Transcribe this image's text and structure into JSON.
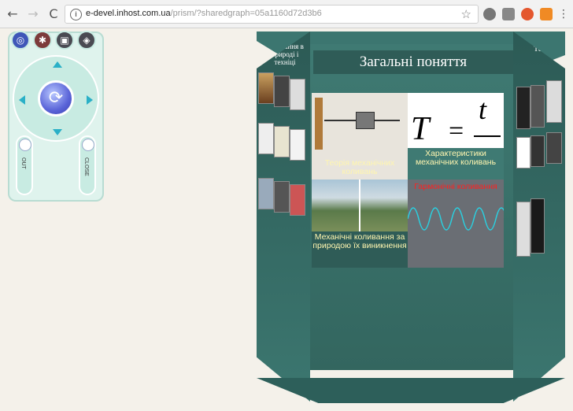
{
  "browser": {
    "url_host": "e-devel.inhost.com.ua",
    "url_path": "/prism/?sharedgraph=05a1160d72d3b6",
    "nav": {
      "back": "←",
      "forward": "→",
      "reload": "C"
    },
    "star": "☆"
  },
  "remote": {
    "tools": [
      "globe-icon",
      "color-wheel-icon",
      "camera-icon",
      "cube-icon"
    ],
    "slider_left_label": "OUT",
    "slider_right_label": "CLOSE"
  },
  "prism": {
    "title": "Загальні поняття",
    "left_side_title": "Коливання в природі і техніці",
    "right_side_title": "Тест",
    "tiles": [
      {
        "label": "Теорія механічних коливань"
      },
      {
        "label": "Характеристики механічних коливань",
        "formula_T": "T",
        "formula_eq": "=",
        "formula_t": "t"
      },
      {
        "label": ""
      },
      {
        "label": "Гармонічні коливання",
        "color": "#ff2020"
      },
      {
        "label": "Механічні коливання за природою їх виникнення"
      },
      {
        "label": ""
      }
    ]
  },
  "colors": {
    "prism": "#3f7a73",
    "panel": "#dff3ed",
    "accent": "#5a64d8"
  }
}
